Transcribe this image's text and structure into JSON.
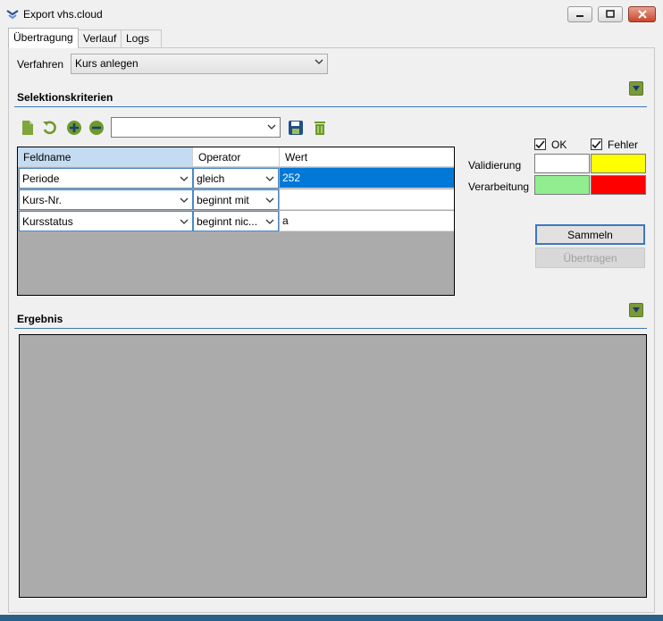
{
  "window": {
    "title": "Export vhs.cloud"
  },
  "tabs": [
    {
      "label": "Übertragung",
      "active": true
    },
    {
      "label": "Verlauf",
      "active": false
    },
    {
      "label": "Logs",
      "active": false
    }
  ],
  "verfahren": {
    "label": "Verfahren",
    "selected": "Kurs anlegen"
  },
  "selection": {
    "title": "Selektionskriterien",
    "toolbar_icons": [
      "new-document-icon",
      "undo-icon",
      "add-icon",
      "remove-icon",
      "save-icon",
      "delete-icon"
    ],
    "filter_combo_value": "",
    "columns": [
      "Feldname",
      "Operator",
      "Wert"
    ],
    "rows": [
      {
        "feldname": "Periode",
        "operator": "gleich",
        "wert": "252"
      },
      {
        "feldname": "Kurs-Nr.",
        "operator": "beginnt mit",
        "wert": ""
      },
      {
        "feldname": "Kursstatus",
        "operator": "beginnt nic...",
        "wert": "a"
      }
    ]
  },
  "legend": {
    "ok_label": "OK",
    "fehler_label": "Fehler",
    "ok_checked": true,
    "fehler_checked": true,
    "validierung_label": "Validierung",
    "verarbeitung_label": "Verarbeitung",
    "colors": {
      "validierung_ok": "#ffffff",
      "validierung_fehler": "#ffff00",
      "verarbeitung_ok": "#90ee90",
      "verarbeitung_fehler": "#ff0000"
    }
  },
  "buttons": {
    "sammeln": "Sammeln",
    "uebertragen": "Übertragen"
  },
  "result": {
    "title": "Ergebnis"
  },
  "colors": {
    "accent_line": "#3c78b4",
    "selected_cell": "#0078d7",
    "collapse_button": "#7a9a3a"
  }
}
